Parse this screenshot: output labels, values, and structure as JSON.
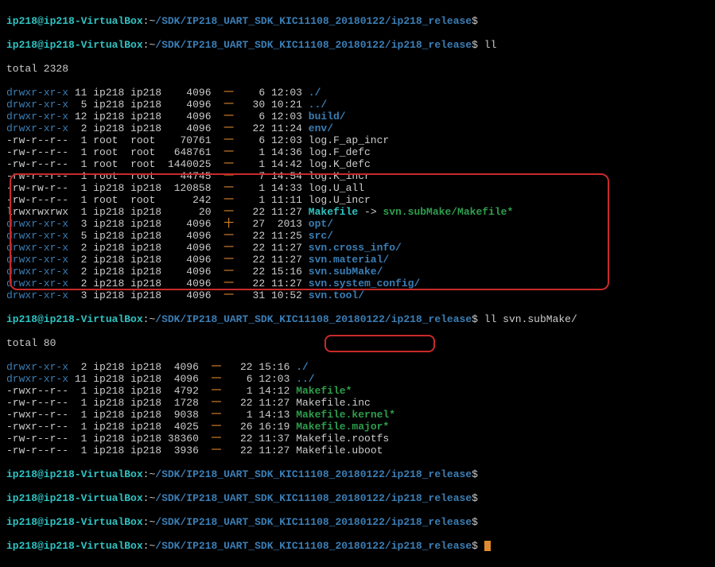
{
  "prompt": {
    "userhost": "ip218@ip218-VirtualBox",
    "colon": ":",
    "tilde": "~",
    "path": "/SDK/IP218_UART_SDK_KIC11108_20180122/ip218_release",
    "dollar": "$"
  },
  "cmds": {
    "empty": "",
    "ll": "ll",
    "ll2": "ll svn.subMake/"
  },
  "totals": {
    "t1": "total 2328",
    "t2": "total 80"
  },
  "ls1": [
    {
      "perm": "drwxr-xr-x",
      "links": "11",
      "u": "ip218",
      "g": "ip218",
      "sz": "   4096",
      "cn": "一",
      "day": "  6",
      "time": "12:03",
      "name": "./",
      "cls": "dir"
    },
    {
      "perm": "drwxr-xr-x",
      "links": " 5",
      "u": "ip218",
      "g": "ip218",
      "sz": "   4096",
      "cn": "一",
      "day": " 30",
      "time": "10:21",
      "name": "../",
      "cls": "dir"
    },
    {
      "perm": "drwxr-xr-x",
      "links": "12",
      "u": "ip218",
      "g": "ip218",
      "sz": "   4096",
      "cn": "一",
      "day": "  6",
      "time": "12:03",
      "name": "build/",
      "cls": "dir"
    },
    {
      "perm": "drwxr-xr-x",
      "links": " 2",
      "u": "ip218",
      "g": "ip218",
      "sz": "   4096",
      "cn": "一",
      "day": " 22",
      "time": "11:24",
      "name": "env/",
      "cls": "dir"
    },
    {
      "perm": "-rw-r--r--",
      "links": " 1",
      "u": "root ",
      "g": "root ",
      "sz": "  70761",
      "cn": "一",
      "day": "  6",
      "time": "12:03",
      "name": "log.F_ap_incr",
      "cls": "file"
    },
    {
      "perm": "-rw-r--r--",
      "links": " 1",
      "u": "root ",
      "g": "root ",
      "sz": " 648761",
      "cn": "一",
      "day": "  1",
      "time": "14:36",
      "name": "log.F_defc",
      "cls": "file"
    },
    {
      "perm": "-rw-r--r--",
      "links": " 1",
      "u": "root ",
      "g": "root ",
      "sz": "1440025",
      "cn": "一",
      "day": "  1",
      "time": "14:42",
      "name": "log.K_defc",
      "cls": "file"
    },
    {
      "perm": "-rw-r--r--",
      "links": " 1",
      "u": "root ",
      "g": "root ",
      "sz": "  44745",
      "cn": "一",
      "day": "  7",
      "time": "14:54",
      "name": "log.K_incr",
      "cls": "file"
    },
    {
      "perm": "-rw-rw-r--",
      "links": " 1",
      "u": "ip218",
      "g": "ip218",
      "sz": " 120858",
      "cn": "一",
      "day": "  1",
      "time": "14:33",
      "name": "log.U_all",
      "cls": "file"
    },
    {
      "perm": "-rw-r--r--",
      "links": " 1",
      "u": "root ",
      "g": "root ",
      "sz": "    242",
      "cn": "一",
      "day": "  1",
      "time": "11:11",
      "name": "log.U_incr",
      "cls": "file"
    },
    {
      "perm": "lrwxrwxrwx",
      "links": " 1",
      "u": "ip218",
      "g": "ip218",
      "sz": "     20",
      "cn": "一",
      "day": " 22",
      "time": "11:27",
      "name": "Makefile",
      "cls": "link",
      "arrow": " -> ",
      "target": "svn.subMake/Makefile*"
    },
    {
      "perm": "drwxr-xr-x",
      "links": " 3",
      "u": "ip218",
      "g": "ip218",
      "sz": "   4096",
      "cn": "十",
      "day": " 27",
      "time": " 2013",
      "name": "opt/",
      "cls": "dir"
    },
    {
      "perm": "drwxr-xr-x",
      "links": " 5",
      "u": "ip218",
      "g": "ip218",
      "sz": "   4096",
      "cn": "一",
      "day": " 22",
      "time": "11:25",
      "name": "src/",
      "cls": "dir"
    },
    {
      "perm": "drwxr-xr-x",
      "links": " 2",
      "u": "ip218",
      "g": "ip218",
      "sz": "   4096",
      "cn": "一",
      "day": " 22",
      "time": "11:27",
      "name": "svn.cross_info/",
      "cls": "dir"
    },
    {
      "perm": "drwxr-xr-x",
      "links": " 2",
      "u": "ip218",
      "g": "ip218",
      "sz": "   4096",
      "cn": "一",
      "day": " 22",
      "time": "11:27",
      "name": "svn.material/",
      "cls": "dir"
    },
    {
      "perm": "drwxr-xr-x",
      "links": " 2",
      "u": "ip218",
      "g": "ip218",
      "sz": "   4096",
      "cn": "一",
      "day": " 22",
      "time": "15:16",
      "name": "svn.subMake/",
      "cls": "dir"
    },
    {
      "perm": "drwxr-xr-x",
      "links": " 2",
      "u": "ip218",
      "g": "ip218",
      "sz": "   4096",
      "cn": "一",
      "day": " 22",
      "time": "11:27",
      "name": "svn.system_config/",
      "cls": "dir"
    },
    {
      "perm": "drwxr-xr-x",
      "links": " 3",
      "u": "ip218",
      "g": "ip218",
      "sz": "   4096",
      "cn": "一",
      "day": " 31",
      "time": "10:52",
      "name": "svn.tool/",
      "cls": "dir"
    }
  ],
  "ls2": [
    {
      "perm": "drwxr-xr-x",
      "links": " 2",
      "u": "ip218",
      "g": "ip218",
      "sz": " 4096",
      "cn": "一",
      "day": " 22",
      "time": "15:16",
      "name": "./",
      "cls": "dir"
    },
    {
      "perm": "drwxr-xr-x",
      "links": "11",
      "u": "ip218",
      "g": "ip218",
      "sz": " 4096",
      "cn": "一",
      "day": "  6",
      "time": "12:03",
      "name": "../",
      "cls": "dir"
    },
    {
      "perm": "-rwxr--r--",
      "links": " 1",
      "u": "ip218",
      "g": "ip218",
      "sz": " 4792",
      "cn": "一",
      "day": "  1",
      "time": "14:12",
      "name": "Makefile*",
      "cls": "exec"
    },
    {
      "perm": "-rw-r--r--",
      "links": " 1",
      "u": "ip218",
      "g": "ip218",
      "sz": " 1728",
      "cn": "一",
      "day": " 22",
      "time": "11:27",
      "name": "Makefile.inc",
      "cls": "file"
    },
    {
      "perm": "-rwxr--r--",
      "links": " 1",
      "u": "ip218",
      "g": "ip218",
      "sz": " 9038",
      "cn": "一",
      "day": "  1",
      "time": "14:13",
      "name": "Makefile.kernel*",
      "cls": "exec"
    },
    {
      "perm": "-rwxr--r--",
      "links": " 1",
      "u": "ip218",
      "g": "ip218",
      "sz": " 4025",
      "cn": "一",
      "day": " 26",
      "time": "16:19",
      "name": "Makefile.major*",
      "cls": "exec"
    },
    {
      "perm": "-rw-r--r--",
      "links": " 1",
      "u": "ip218",
      "g": "ip218",
      "sz": "38360",
      "cn": "一",
      "day": " 22",
      "time": "11:37",
      "name": "Makefile.rootfs",
      "cls": "file"
    },
    {
      "perm": "-rw-r--r--",
      "links": " 1",
      "u": "ip218",
      "g": "ip218",
      "sz": " 3936",
      "cn": "一",
      "day": " 22",
      "time": "11:27",
      "name": "Makefile.uboot",
      "cls": "file"
    }
  ]
}
